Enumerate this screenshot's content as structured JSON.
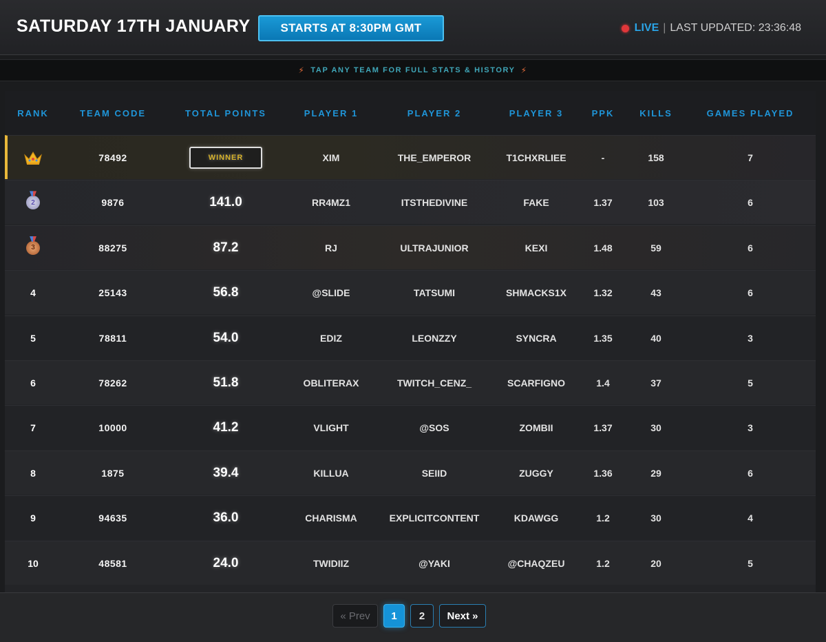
{
  "header": {
    "title": "SATURDAY 17TH JANUARY",
    "start_button": "STARTS AT 8:30PM GMT",
    "live_label": "LIVE",
    "separator": "|",
    "last_updated": "LAST UPDATED: 23:36:48"
  },
  "hint": {
    "text": "TAP ANY TEAM FOR FULL STATS & HISTORY",
    "bolt": "⚡"
  },
  "columns": [
    "RANK",
    "TEAM CODE",
    "TOTAL POINTS",
    "PLAYER 1",
    "PLAYER 2",
    "PLAYER 3",
    "PPK",
    "KILLS",
    "GAMES PLAYED"
  ],
  "rows": [
    {
      "rank": "1",
      "rank_icon": "crown-icon",
      "code": "78492",
      "points": "WINNER",
      "p1": "XIM",
      "p2": "THE_EMPEROR",
      "p3": "T1CHXRLIEE",
      "ppk": "-",
      "kills": "158",
      "games": "7"
    },
    {
      "rank": "2",
      "rank_icon": "silver-medal-icon",
      "medal_label": "2",
      "code": "9876",
      "points": "141.0",
      "p1": "RR4MZ1",
      "p2": "ITSTHEDIVINE",
      "p3": "FAKE",
      "ppk": "1.37",
      "kills": "103",
      "games": "6"
    },
    {
      "rank": "3",
      "rank_icon": "bronze-medal-icon",
      "medal_label": "3",
      "code": "88275",
      "points": "87.2",
      "p1": "RJ",
      "p2": "ULTRAJUNIOR",
      "p3": "KEXI",
      "ppk": "1.48",
      "kills": "59",
      "games": "6"
    },
    {
      "rank": "4",
      "code": "25143",
      "points": "56.8",
      "p1": "@SLIDE",
      "p2": "TATSUMI",
      "p3": "SHMACKS1X",
      "ppk": "1.32",
      "kills": "43",
      "games": "6"
    },
    {
      "rank": "5",
      "code": "78811",
      "points": "54.0",
      "p1": "EDIZ",
      "p2": "LEONZZY",
      "p3": "SYNCRA",
      "ppk": "1.35",
      "kills": "40",
      "games": "3"
    },
    {
      "rank": "6",
      "code": "78262",
      "points": "51.8",
      "p1": "OBLITERAX",
      "p2": "TWITCH_CENZ_",
      "p3": "SCARFIGNO",
      "ppk": "1.4",
      "kills": "37",
      "games": "5"
    },
    {
      "rank": "7",
      "code": "10000",
      "points": "41.2",
      "p1": "VLIGHT",
      "p2": "@SOS",
      "p3": "ZOMBII",
      "ppk": "1.37",
      "kills": "30",
      "games": "3"
    },
    {
      "rank": "8",
      "code": "1875",
      "points": "39.4",
      "p1": "KILLUA",
      "p2": "SEIID",
      "p3": "ZUGGY",
      "ppk": "1.36",
      "kills": "29",
      "games": "6"
    },
    {
      "rank": "9",
      "code": "94635",
      "points": "36.0",
      "p1": "CHARISMA",
      "p2": "EXPLICITCONTENT",
      "p3": "KDAWGG",
      "ppk": "1.2",
      "kills": "30",
      "games": "4"
    },
    {
      "rank": "10",
      "code": "48581",
      "points": "24.0",
      "p1": "TWIDIIZ",
      "p2": "@YAKI",
      "p3": "@CHAQZEU",
      "ppk": "1.2",
      "kills": "20",
      "games": "5"
    }
  ],
  "pagination": {
    "prev": "« Prev",
    "pages": [
      "1",
      "2"
    ],
    "current": "1",
    "next": "Next »"
  },
  "colors": {
    "accent": "#1f95d8",
    "live": "#e0373a",
    "gold": "#e9b83a"
  }
}
